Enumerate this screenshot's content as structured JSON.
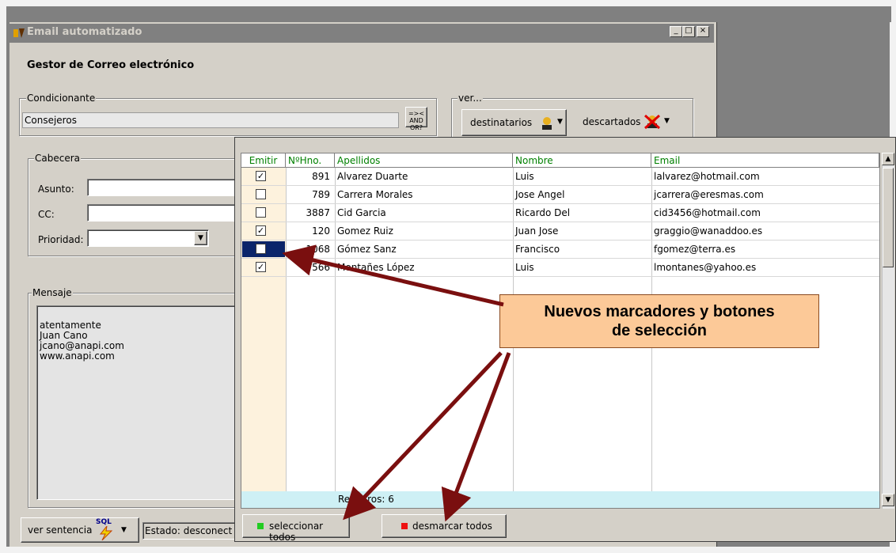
{
  "window": {
    "title": "Email automatizado",
    "heading": "Gestor de Correo electrónico",
    "controls": [
      "_",
      "□",
      "×"
    ]
  },
  "condicionante": {
    "label": "Condicionante",
    "value": "Consejeros",
    "logic_button": "=>< AND OR?"
  },
  "ver": {
    "label": "ver...",
    "destinatarios": "destinatarios",
    "descartados": "descartados"
  },
  "cabecera": {
    "label": "Cabecera",
    "asunto": "Asunto:",
    "cc": "CC:",
    "prioridad": "Prioridad:"
  },
  "mensaje": {
    "label": "Mensaje",
    "lines": [
      "atentamente",
      "Juan Cano",
      "jcano@anapi.com",
      "www.anapi.com"
    ]
  },
  "bottom": {
    "ver_sentencia": "ver sentencia",
    "sql": "SQL",
    "estado": "Estado: desconect"
  },
  "grid": {
    "headers": [
      "Emitir",
      "NºHno.",
      "Apellidos",
      "Nombre",
      "Email"
    ],
    "rows": [
      {
        "checked": true,
        "num": "891",
        "apellidos": "Alvarez Duarte",
        "nombre": "Luis",
        "email": "lalvarez@hotmail.com"
      },
      {
        "checked": false,
        "num": "789",
        "apellidos": "Carrera Morales",
        "nombre": "Jose Angel",
        "email": "jcarrera@eresmas.com"
      },
      {
        "checked": false,
        "num": "3887",
        "apellidos": "Cid Garcia",
        "nombre": "Ricardo Del",
        "email": "cid3456@hotmail.com"
      },
      {
        "checked": true,
        "num": "120",
        "apellidos": "Gomez Ruiz",
        "nombre": "Juan Jose",
        "email": "graggio@wanaddoo.es"
      },
      {
        "checked": false,
        "num": "1068",
        "apellidos": "Gómez Sanz",
        "nombre": "Francisco",
        "email": "fgomez@terra.es"
      },
      {
        "checked": true,
        "num": "566",
        "apellidos": "Montañes López",
        "nombre": "Luis",
        "email": "lmontanes@yahoo.es"
      }
    ],
    "footer": "Registros: 6"
  },
  "buttons": {
    "select_all": "seleccionar todos",
    "deselect_all": "desmarcar todos"
  },
  "callout": {
    "line1": "Nuevos marcadores y botones",
    "line2": "de selección"
  },
  "colors": {
    "arrow": "#7a0f0f",
    "callout_bg": "#fcc998",
    "header_text": "#008000",
    "emit_col": "#fdf2dd",
    "footer_row": "#cef0f5"
  }
}
